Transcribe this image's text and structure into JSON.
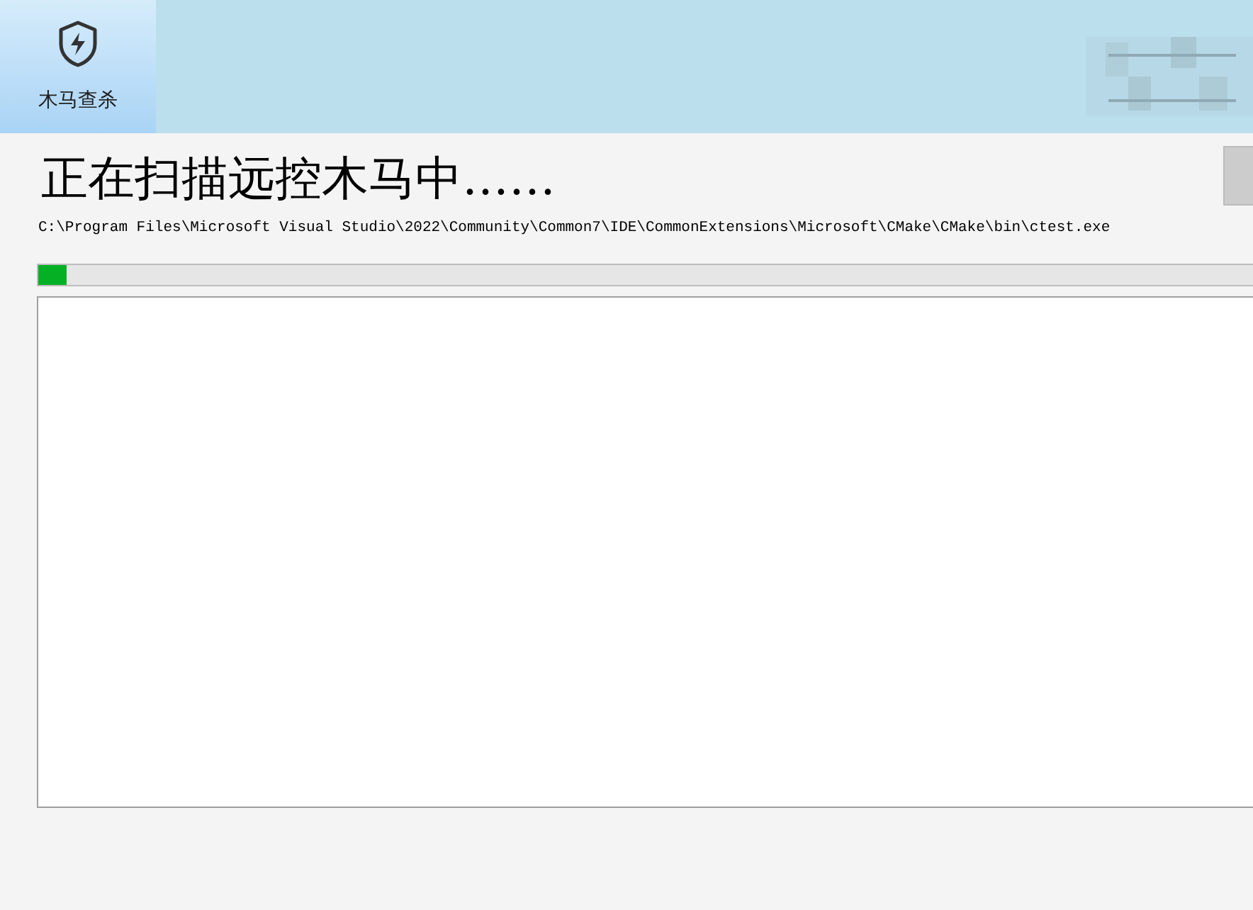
{
  "nav": {
    "items": [
      {
        "label": "木马查杀",
        "selected": true
      }
    ]
  },
  "scan": {
    "title": "正在扫描远控木马中……",
    "path": "C:\\Program Files\\Microsoft Visual Studio\\2022\\Community\\Common7\\IDE\\CommonExtensions\\Microsoft\\CMake\\CMake\\bin\\ctest.exe",
    "progress": {
      "level": 0.023
    }
  }
}
